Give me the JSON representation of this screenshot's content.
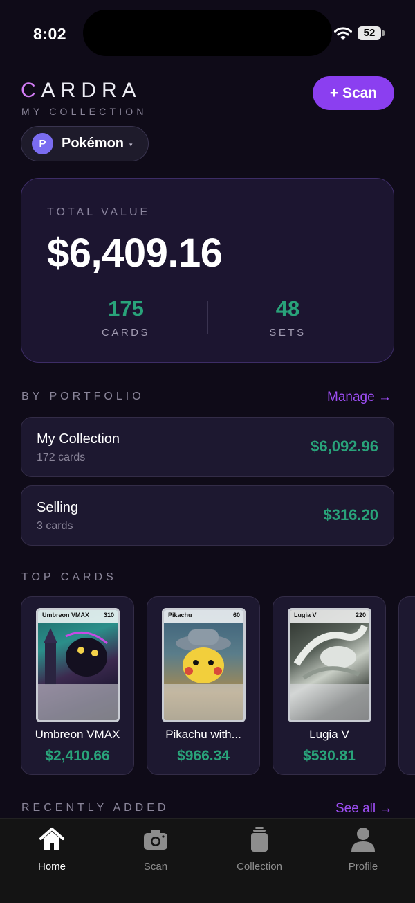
{
  "status_bar": {
    "time": "8:02",
    "battery": "52"
  },
  "header": {
    "brand": "CARDRA",
    "brand_first": "C",
    "brand_rest": "ARDRA",
    "subtitle": "MY COLLECTION",
    "scan_button": "+ Scan",
    "game_selector": {
      "badge": "P",
      "label": "Pokémon",
      "caret": "▾"
    }
  },
  "summary": {
    "label": "TOTAL VALUE",
    "total": "$6,409.16",
    "cards_count": "175",
    "cards_label": "CARDS",
    "sets_count": "48",
    "sets_label": "SETS"
  },
  "portfolio": {
    "title": "BY PORTFOLIO",
    "link": "Manage →",
    "items": [
      {
        "name": "My Collection",
        "count": "172 cards",
        "value": "$6,092.96"
      },
      {
        "name": "Selling",
        "count": "3 cards",
        "value": "$316.20"
      }
    ]
  },
  "top_cards": {
    "title": "TOP CARDS",
    "items": [
      {
        "name": "Umbreon VMAX",
        "price": "$2,410.66",
        "art_name": "Umbreon VMAX",
        "hp": "310"
      },
      {
        "name": "Pikachu with...",
        "price": "$966.34",
        "art_name": "Pikachu",
        "hp": "60"
      },
      {
        "name": "Lugia V",
        "price": "$530.81",
        "art_name": "Lugia V",
        "hp": "220"
      }
    ]
  },
  "recent": {
    "title": "RECENTLY ADDED",
    "link": "See all →"
  },
  "nav": {
    "items": [
      {
        "label": "Home",
        "icon": "home-icon",
        "active": true
      },
      {
        "label": "Scan",
        "icon": "camera-icon"
      },
      {
        "label": "Collection",
        "icon": "collection-icon"
      },
      {
        "label": "Profile",
        "icon": "profile-icon"
      }
    ]
  },
  "colors": {
    "background": "#0f0b18",
    "accent": "#8b3ff0",
    "positive": "#29a37a",
    "brand_letter": "#d27cf5"
  }
}
